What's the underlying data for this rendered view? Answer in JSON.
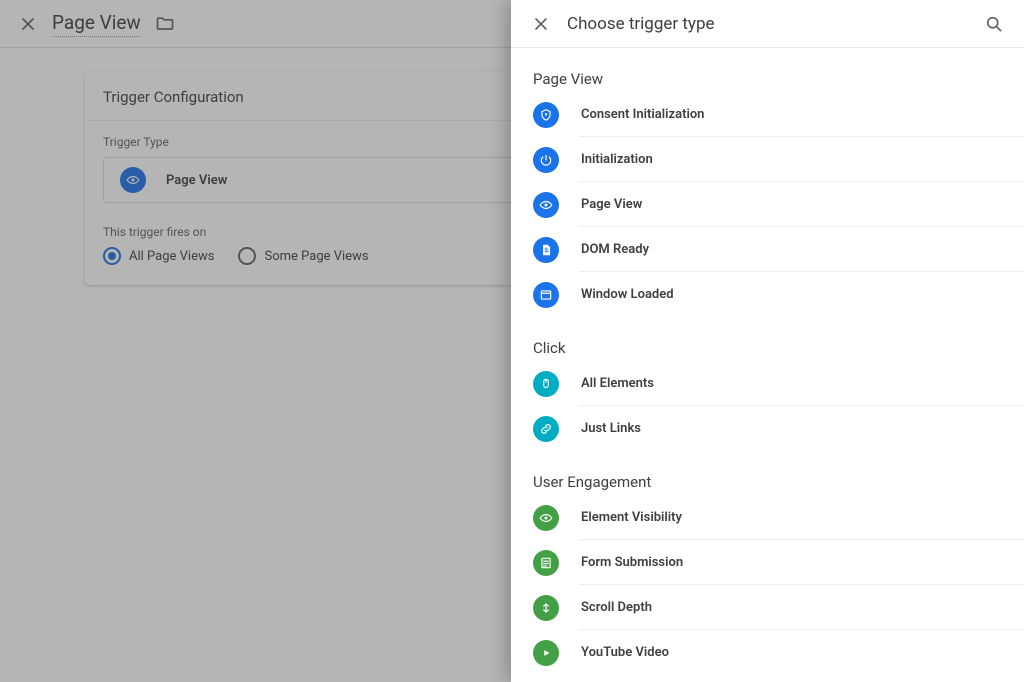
{
  "header": {
    "title": "Page View"
  },
  "card": {
    "title": "Trigger Configuration",
    "trigger_type_label": "Trigger Type",
    "selected_type": "Page View",
    "fires_on_label": "This trigger fires on",
    "radio_options": {
      "all": "All Page Views",
      "some": "Some Page Views"
    }
  },
  "panel": {
    "title": "Choose trigger type",
    "sections": [
      {
        "title": "Page View",
        "items": [
          {
            "label": "Consent Initialization",
            "icon": "shield",
            "color": "c-blue1"
          },
          {
            "label": "Initialization",
            "icon": "power",
            "color": "c-blue1"
          },
          {
            "label": "Page View",
            "icon": "eye",
            "color": "c-blue1"
          },
          {
            "label": "DOM Ready",
            "icon": "doc",
            "color": "c-blue1"
          },
          {
            "label": "Window Loaded",
            "icon": "window",
            "color": "c-blue1"
          }
        ]
      },
      {
        "title": "Click",
        "items": [
          {
            "label": "All Elements",
            "icon": "mouse",
            "color": "c-cyan"
          },
          {
            "label": "Just Links",
            "icon": "link",
            "color": "c-cyan"
          }
        ]
      },
      {
        "title": "User Engagement",
        "items": [
          {
            "label": "Element Visibility",
            "icon": "eye",
            "color": "c-green"
          },
          {
            "label": "Form Submission",
            "icon": "form",
            "color": "c-green"
          },
          {
            "label": "Scroll Depth",
            "icon": "scroll",
            "color": "c-green"
          },
          {
            "label": "YouTube Video",
            "icon": "play",
            "color": "c-green"
          }
        ]
      }
    ]
  }
}
